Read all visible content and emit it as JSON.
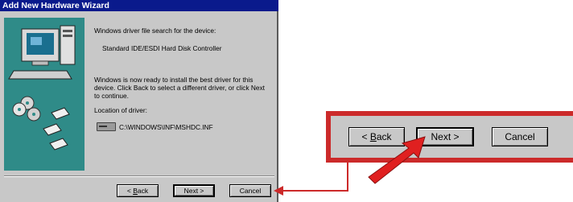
{
  "window": {
    "title": "Add New Hardware Wizard"
  },
  "content": {
    "heading": "Windows driver file search for the device:",
    "device_name": "Standard IDE/ESDI Hard Disk Controller",
    "message_line1": "Windows is now ready to install the best driver for this",
    "message_line2": "device. Click Back to select a different driver, or click Next",
    "message_line3": "to continue.",
    "location_label": "Location of driver:",
    "driver_path": "C:\\WINDOWS\\INF\\MSHDC.INF"
  },
  "buttons": {
    "back_mnemonic": "B",
    "back_rest": "ack",
    "back_prefix": "< ",
    "next_label": "Next >",
    "cancel_label": "Cancel"
  },
  "icons": [
    "computer-icon",
    "cd-icon",
    "floppy-disk-icon",
    "drive-icon",
    "arrow-icon"
  ],
  "colors": {
    "title_bar": "#0a1a8c",
    "dialog_bg": "#c8c8c8",
    "art_bg": "#2f8b88",
    "callout": "#cc2a2a"
  }
}
